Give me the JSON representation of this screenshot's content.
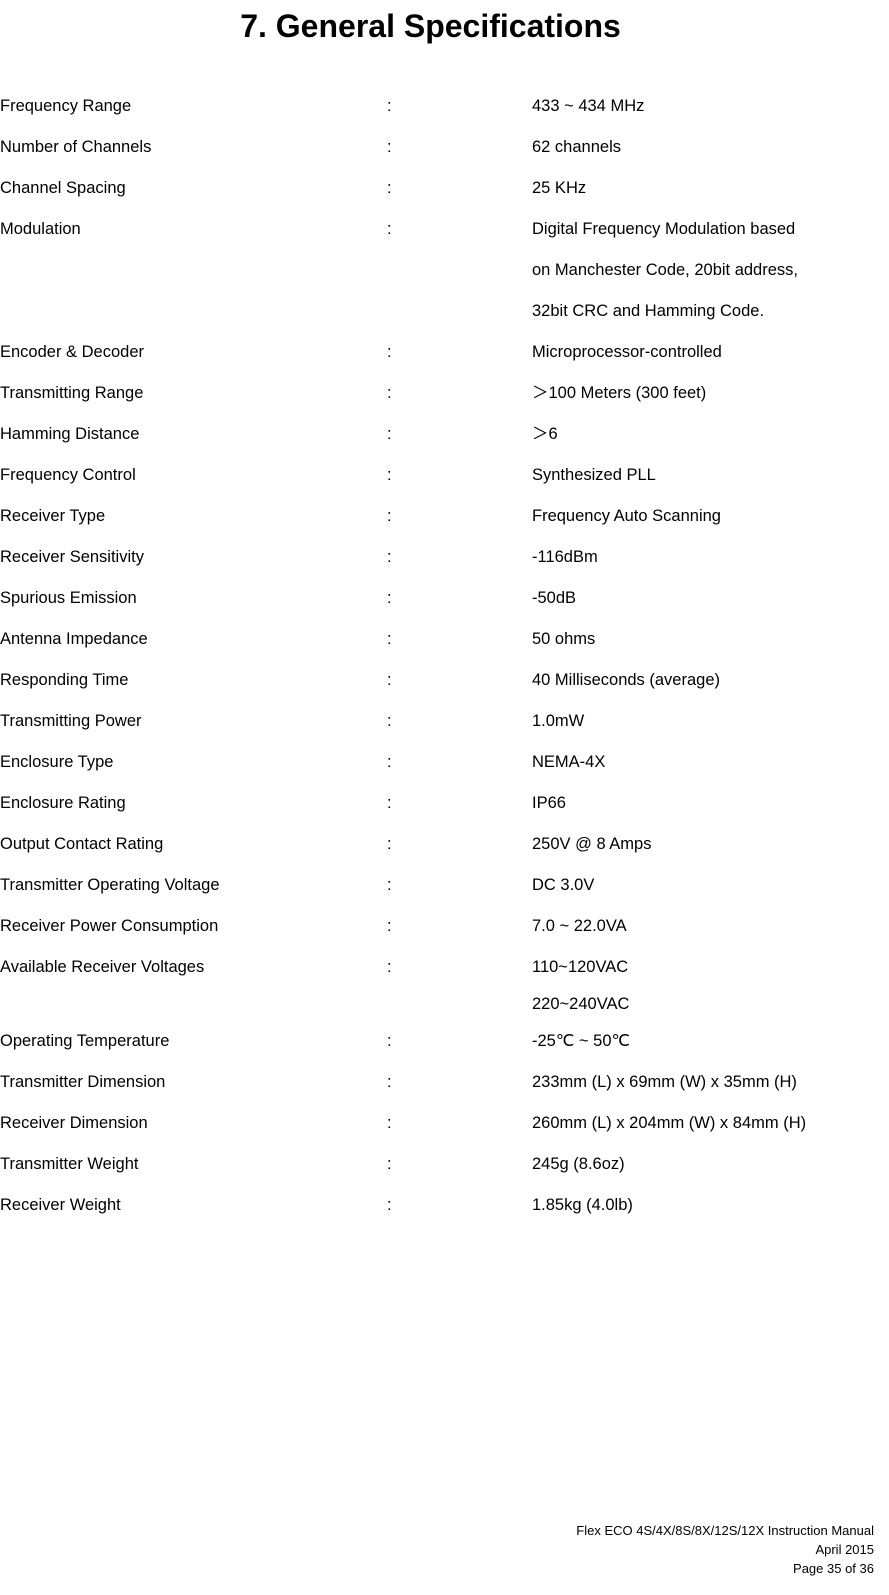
{
  "document": {
    "title": "7. General Specifications",
    "separator": ":",
    "specs": [
      {
        "label": "Frequency Range",
        "value": "433 ~ 434 MHz",
        "lines": []
      },
      {
        "label": "Number of Channels",
        "value": "62 channels",
        "lines": []
      },
      {
        "label": "Channel Spacing",
        "value": "25 KHz",
        "lines": []
      },
      {
        "label": "Modulation",
        "value": "Digital Frequency Modulation based",
        "lines": [
          "on Manchester Code, 20bit address,",
          "32bit CRC and Hamming Code."
        ]
      },
      {
        "label": "Encoder & Decoder",
        "value": "Microprocessor-controlled",
        "lines": []
      },
      {
        "label": "Transmitting Range",
        "value": "＞100 Meters (300 feet)",
        "lines": []
      },
      {
        "label": "Hamming Distance",
        "value": "＞6",
        "lines": []
      },
      {
        "label": "Frequency Control",
        "value": "Synthesized PLL",
        "lines": []
      },
      {
        "label": "Receiver Type",
        "value": "Frequency Auto Scanning",
        "lines": []
      },
      {
        "label": "Receiver Sensitivity",
        "value": "-116dBm",
        "lines": []
      },
      {
        "label": "Spurious Emission",
        "value": "-50dB",
        "lines": []
      },
      {
        "label": "Antenna Impedance",
        "value": "50 ohms",
        "lines": []
      },
      {
        "label": "Responding Time",
        "value": "40 Milliseconds (average)",
        "lines": []
      },
      {
        "label": "Transmitting Power",
        "value": "1.0mW",
        "lines": []
      },
      {
        "label": "Enclosure Type",
        "value": "NEMA-4X",
        "lines": []
      },
      {
        "label": "Enclosure Rating",
        "value": "IP66",
        "lines": []
      },
      {
        "label": "Output Contact Rating",
        "value": "250V @ 8 Amps",
        "lines": []
      },
      {
        "label": "Transmitter Operating Voltage",
        "value": "DC 3.0V",
        "lines": []
      },
      {
        "label": "Receiver Power Consumption",
        "value": "7.0 ~ 22.0VA",
        "lines": []
      },
      {
        "label": "Available Receiver Voltages",
        "value": "110~120VAC",
        "lines": [
          "220~240VAC"
        ],
        "tight": true
      },
      {
        "label": "Operating Temperature",
        "value": "-25℃ ~ 50℃",
        "lines": []
      },
      {
        "label": "Transmitter Dimension",
        "value": "233mm (L) x 69mm (W) x 35mm (H)",
        "lines": []
      },
      {
        "label": "Receiver Dimension",
        "value": "260mm (L) x 204mm (W) x 84mm (H)",
        "lines": []
      },
      {
        "label": "Transmitter Weight",
        "value": "245g (8.6oz)",
        "lines": []
      },
      {
        "label": "Receiver Weight",
        "value": "1.85kg (4.0lb)",
        "lines": []
      }
    ]
  },
  "footer": {
    "manual": "Flex ECO 4S/4X/8S/8X/12S/12X Instruction Manual",
    "date": "April 2015",
    "page": "Page 35 of 36"
  }
}
